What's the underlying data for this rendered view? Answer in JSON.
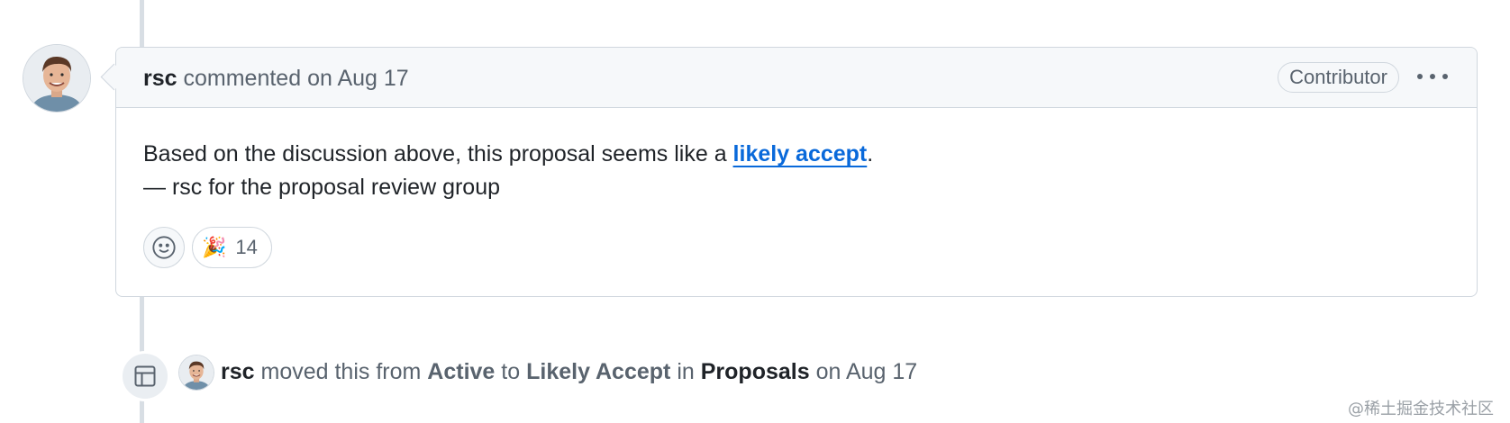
{
  "comment": {
    "author": "rsc",
    "action": "commented",
    "date_prefix": "on",
    "date": "Aug 17",
    "role_badge": "Contributor",
    "body_before_link": "Based on the discussion above, this proposal seems like a ",
    "link_text": "likely accept",
    "body_after_link": ".",
    "body_line2": "— rsc for the proposal review group",
    "reactions": [
      {
        "emoji": "🎉",
        "count": "14"
      }
    ]
  },
  "event": {
    "author": "rsc",
    "moved_text": "moved this from",
    "from": "Active",
    "to_word": "to",
    "to": "Likely Accept",
    "in_word": "in",
    "project": "Proposals",
    "date_prefix": "on",
    "date": "Aug 17"
  },
  "watermark": "@稀土掘金技术社区",
  "icons": {
    "add_reaction": "smiley-icon",
    "project": "table-icon",
    "menu": "kebab-horizontal-icon"
  }
}
